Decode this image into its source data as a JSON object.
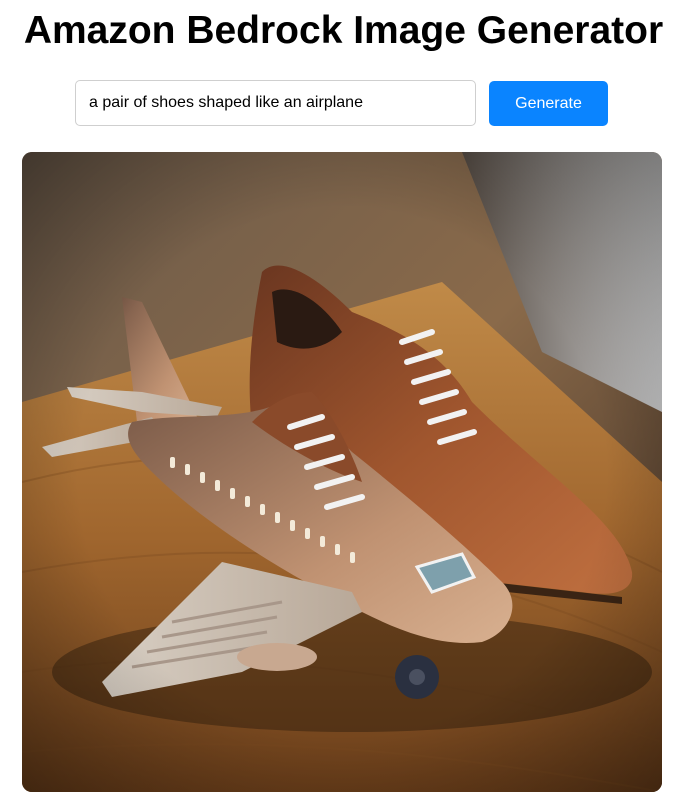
{
  "header": {
    "title": "Amazon Bedrock Image Generator"
  },
  "prompt": {
    "value": "a pair of shoes shaped like an airplane",
    "placeholder": ""
  },
  "actions": {
    "generate_label": "Generate"
  },
  "result": {
    "image_subject": "brown leather shoes beside a shoe-shaped toy airplane on a wooden table",
    "colors": {
      "wood": "#9a6a3a",
      "leather": "#8a4a2a",
      "plane_body": "#b88a6a",
      "laces": "#f2f2f2"
    }
  },
  "theme": {
    "accent": "#0a84ff"
  }
}
